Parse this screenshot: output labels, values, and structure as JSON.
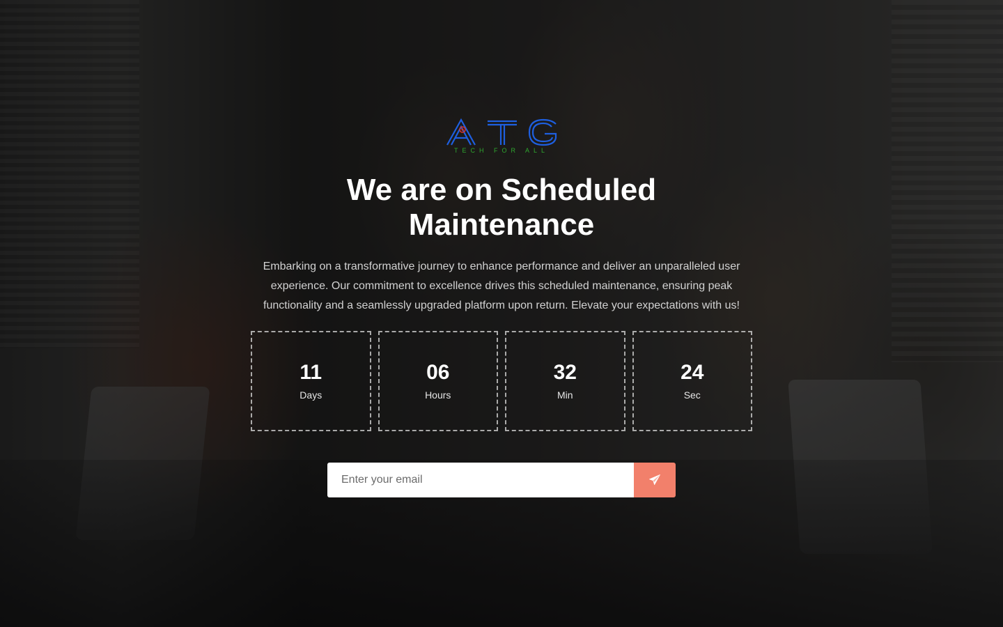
{
  "logo": {
    "wordmark": "ATG",
    "tagline": "TECH FOR ALL",
    "colors": {
      "wordmark": "#1e5fe0",
      "tagline": "#2fa82f",
      "accent": "#d9342b"
    }
  },
  "hero": {
    "title": "We are on Scheduled Maintenance",
    "description": "Embarking on a transformative journey to enhance performance and deliver an unparalleled user experience. Our commitment to excellence drives this scheduled maintenance, ensuring peak functionality and a seamlessly upgraded platform upon return. Elevate your expectations with us!"
  },
  "countdown": [
    {
      "value": "11",
      "label": "Days"
    },
    {
      "value": "06",
      "label": "Hours"
    },
    {
      "value": "32",
      "label": "Min"
    },
    {
      "value": "24",
      "label": "Sec"
    }
  ],
  "subscribe": {
    "email_placeholder": "Enter your email",
    "email_value": "",
    "button_icon": "paper-plane-icon",
    "button_color": "#f2806b"
  }
}
